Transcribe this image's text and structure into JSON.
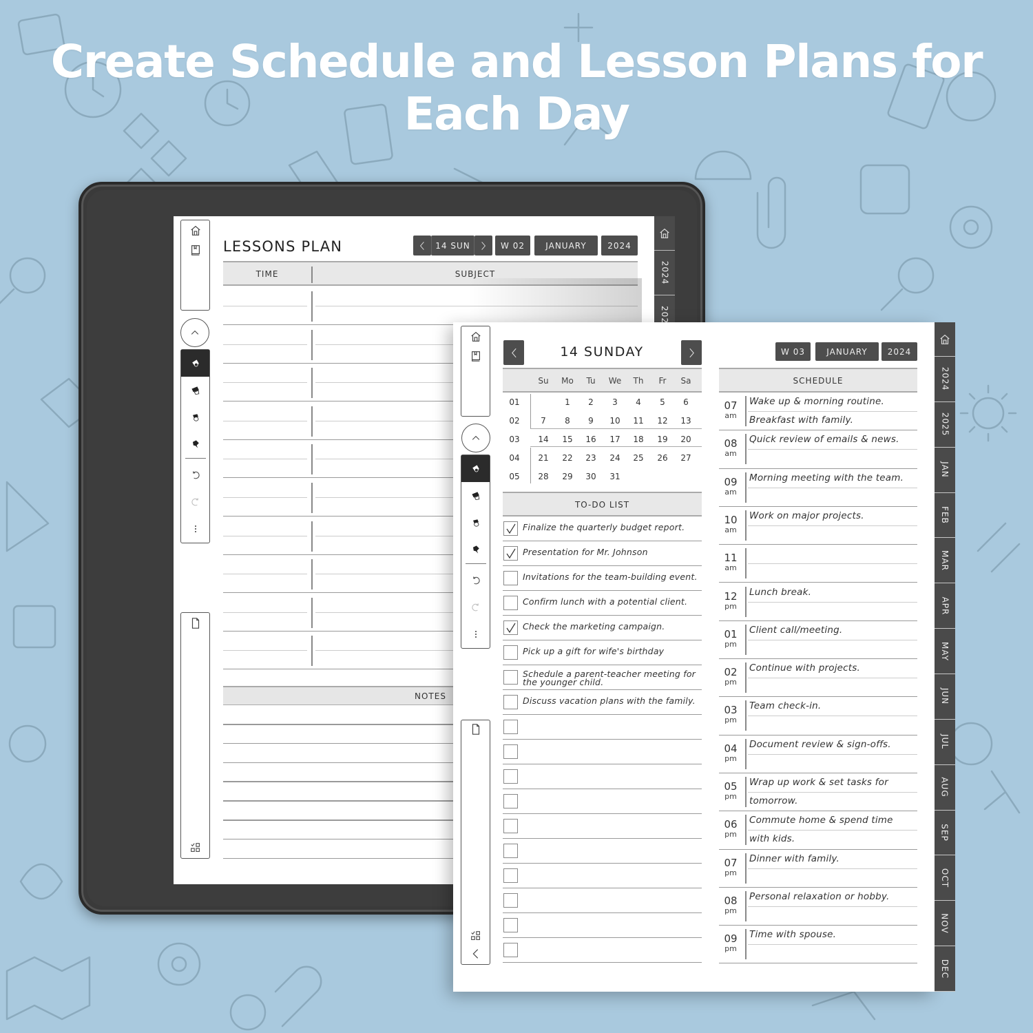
{
  "headline": {
    "line1": "Create Schedule and Lesson Plans for",
    "line2": "Each Day"
  },
  "colors": {
    "background": "#a9c9de",
    "chip": "#4d4d4d",
    "tab": "#4a4a4a",
    "header_band": "#e8e8e8"
  },
  "back_page": {
    "title": "LESSONS PLAN",
    "nav": {
      "prev_icon": "chevron-left-icon",
      "date": "14 SUN",
      "next_icon": "chevron-right-icon",
      "week": "W 02",
      "month": "JANUARY",
      "year": "2024"
    },
    "columns": {
      "time": "TIME",
      "subject": "SUBJECT"
    },
    "notes_label": "NOTES",
    "side_tabs": [
      "2024",
      "202"
    ],
    "toolbar_icons": [
      "home-icon",
      "notebook-icon",
      "scroll-up-icon",
      "pen-icon",
      "marker-icon",
      "eraser-icon",
      "lasso-icon",
      "undo-icon",
      "redo-icon",
      "more-icon",
      "page-icon",
      "templates-icon"
    ]
  },
  "front_page": {
    "day_title": "14 SUNDAY",
    "chips": {
      "week": "W 03",
      "month": "JANUARY",
      "year": "2024"
    },
    "calendar": {
      "weekdays": [
        "Su",
        "Mo",
        "Tu",
        "We",
        "Th",
        "Fr",
        "Sa"
      ],
      "weeks": [
        {
          "wk": "01",
          "days": [
            "",
            "1",
            "2",
            "3",
            "4",
            "5",
            "6"
          ]
        },
        {
          "wk": "02",
          "days": [
            "7",
            "8",
            "9",
            "10",
            "11",
            "12",
            "13"
          ]
        },
        {
          "wk": "03",
          "days": [
            "14",
            "15",
            "16",
            "17",
            "18",
            "19",
            "20"
          ]
        },
        {
          "wk": "04",
          "days": [
            "21",
            "22",
            "23",
            "24",
            "25",
            "26",
            "27"
          ]
        },
        {
          "wk": "05",
          "days": [
            "28",
            "29",
            "30",
            "31",
            "",
            "",
            ""
          ]
        }
      ]
    },
    "todo": {
      "title": "TO-DO LIST",
      "items": [
        {
          "text": "Finalize the quarterly budget report.",
          "checked": true
        },
        {
          "text": "Presentation for Mr. Johnson",
          "checked": true
        },
        {
          "text": "Invitations for the team-building event.",
          "checked": false
        },
        {
          "text": "Confirm lunch with a potential client.",
          "checked": false
        },
        {
          "text": "Check the marketing campaign.",
          "checked": true
        },
        {
          "text": "Pick up a gift for wife's birthday",
          "checked": false
        },
        {
          "text": "Schedule a parent-teacher meeting for the younger child.",
          "checked": false
        },
        {
          "text": "Discuss vacation plans with the family.",
          "checked": false
        },
        {
          "text": "",
          "checked": false
        },
        {
          "text": "",
          "checked": false
        },
        {
          "text": "",
          "checked": false
        },
        {
          "text": "",
          "checked": false
        },
        {
          "text": "",
          "checked": false
        },
        {
          "text": "",
          "checked": false
        },
        {
          "text": "",
          "checked": false
        },
        {
          "text": "",
          "checked": false
        },
        {
          "text": "",
          "checked": false
        },
        {
          "text": "",
          "checked": false
        }
      ]
    },
    "schedule": {
      "title": "SCHEDULE",
      "slots": [
        {
          "hour": "07",
          "ampm": "am",
          "line1": "Wake up & morning routine.",
          "line2": "Breakfast with family."
        },
        {
          "hour": "08",
          "ampm": "am",
          "line1": "Quick review of emails & news.",
          "line2": ""
        },
        {
          "hour": "09",
          "ampm": "am",
          "line1": "Morning meeting with the team.",
          "line2": ""
        },
        {
          "hour": "10",
          "ampm": "am",
          "line1": "Work on major projects.",
          "line2": ""
        },
        {
          "hour": "11",
          "ampm": "am",
          "line1": "",
          "line2": ""
        },
        {
          "hour": "12",
          "ampm": "pm",
          "line1": "Lunch break.",
          "line2": ""
        },
        {
          "hour": "01",
          "ampm": "pm",
          "line1": "Client call/meeting.",
          "line2": ""
        },
        {
          "hour": "02",
          "ampm": "pm",
          "line1": "Continue with projects.",
          "line2": ""
        },
        {
          "hour": "03",
          "ampm": "pm",
          "line1": "Team check-in.",
          "line2": ""
        },
        {
          "hour": "04",
          "ampm": "pm",
          "line1": "Document review & sign-offs.",
          "line2": ""
        },
        {
          "hour": "05",
          "ampm": "pm",
          "line1": "Wrap up work & set tasks for",
          "line2": "tomorrow."
        },
        {
          "hour": "06",
          "ampm": "pm",
          "line1": "Commute home & spend time",
          "line2": "with kids."
        },
        {
          "hour": "07",
          "ampm": "pm",
          "line1": "Dinner with family.",
          "line2": ""
        },
        {
          "hour": "08",
          "ampm": "pm",
          "line1": "Personal relaxation or hobby.",
          "line2": ""
        },
        {
          "hour": "09",
          "ampm": "pm",
          "line1": "Time with spouse.",
          "line2": ""
        }
      ]
    },
    "side_tabs": [
      "2024",
      "2025",
      "JAN",
      "FEB",
      "MAR",
      "APR",
      "MAY",
      "JUN",
      "JUL",
      "AUG",
      "SEP",
      "OCT",
      "NOV",
      "DEC"
    ]
  }
}
